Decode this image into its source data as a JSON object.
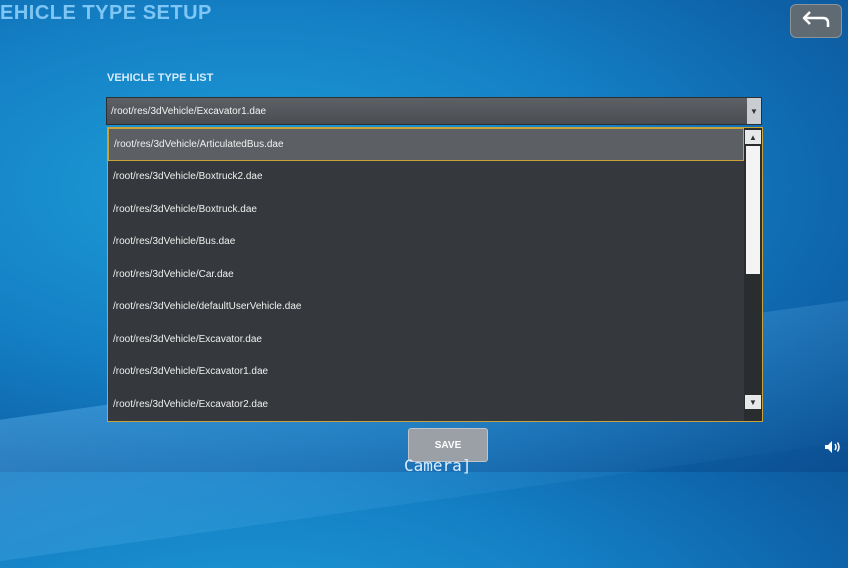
{
  "header": {
    "title": "EHICLE TYPE SETUP"
  },
  "list_label": "VEHICLE TYPE LIST",
  "selected_value": "/root/res/3dVehicle/Excavator1.dae",
  "items": [
    "/root/res/3dVehicle/ArticulatedBus.dae",
    "/root/res/3dVehicle/Boxtruck2.dae",
    "/root/res/3dVehicle/Boxtruck.dae",
    "/root/res/3dVehicle/Bus.dae",
    "/root/res/3dVehicle/Car.dae",
    "/root/res/3dVehicle/defaultUserVehicle.dae",
    "/root/res/3dVehicle/Excavator.dae",
    "/root/res/3dVehicle/Excavator1.dae",
    "/root/res/3dVehicle/Excavator2.dae"
  ],
  "highlighted_index": 0,
  "save_label": "SAVE",
  "footer_label": "Camera]",
  "icons": {
    "back": "back-arrow-icon",
    "dropdown": "triangle-down-icon",
    "scroll_up": "triangle-up-icon",
    "scroll_down": "triangle-down-icon",
    "volume": "speaker-icon"
  }
}
